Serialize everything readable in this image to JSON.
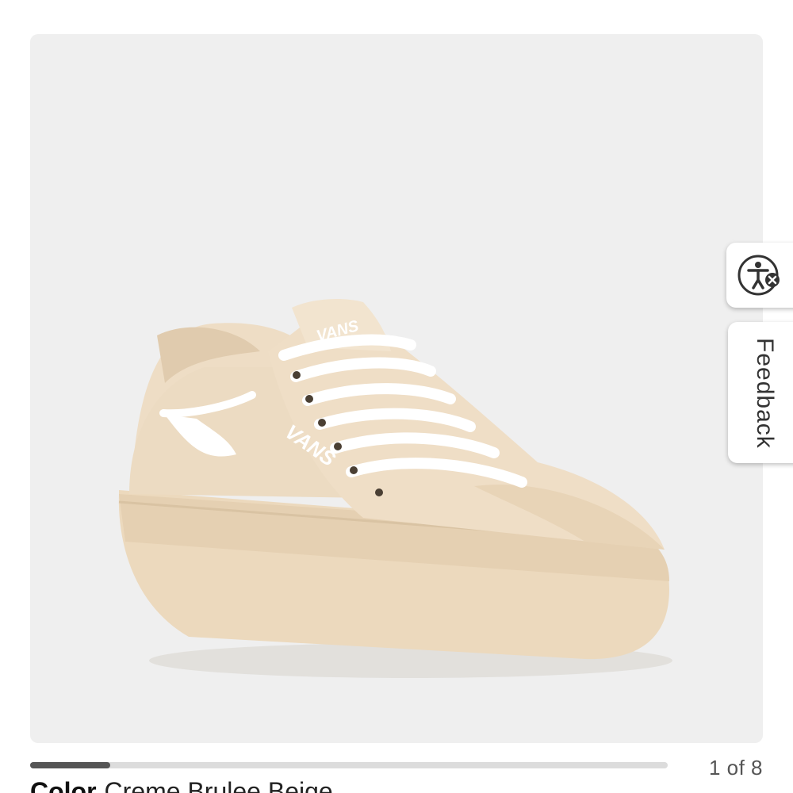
{
  "gallery": {
    "image_alt": "Vans platform sneaker in Creme Brulee Beige",
    "brand_mark_tongue": "VANS",
    "brand_mark_side": "VANS",
    "image_counter": "1 of 8",
    "progress": 0.125,
    "progress_color": "#555555",
    "track_color": "#dcdcdc"
  },
  "product": {
    "color_label": "Color",
    "color_value": "Creme Brulee Beige"
  },
  "side_tabs": {
    "accessibility_icon": "accessibility-icon",
    "feedback_label": "Feedback"
  }
}
